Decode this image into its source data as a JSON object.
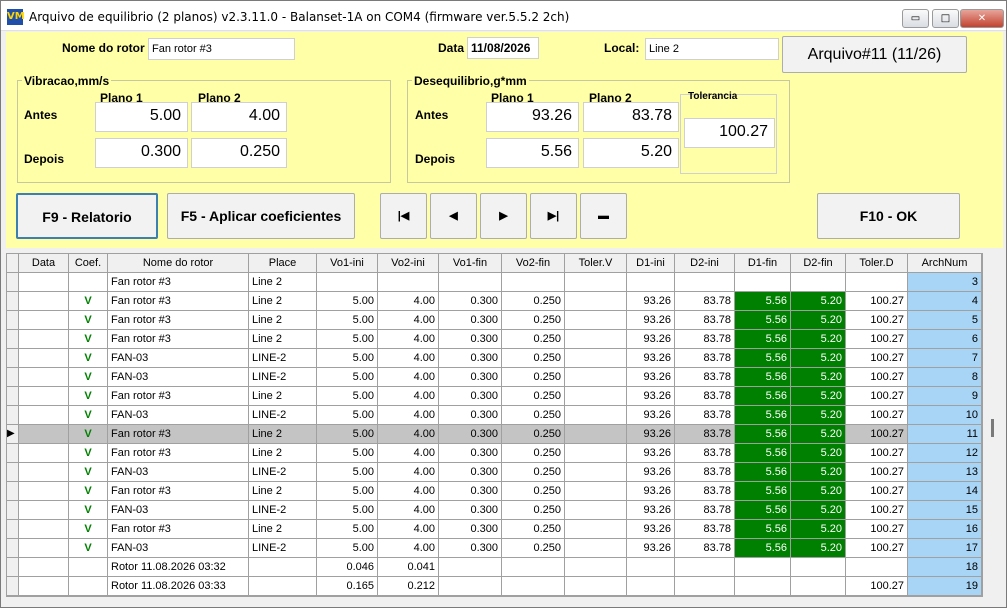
{
  "window": {
    "title": "Arquivo de equilibrio (2 planos) v2.3.11.0 - Balanset-1A on COM4 (firmware ver.5.5.2 2ch)",
    "icon_text": "VM",
    "btn_minimize": "▭",
    "btn_maximize": "□",
    "btn_close": "✕"
  },
  "header": {
    "rotor_label": "Nome do rotor",
    "rotor_value": "Fan rotor #3",
    "date_label": "Data",
    "date_value": "11/08/2026",
    "local_label": "Local:",
    "local_value": "Line 2",
    "archive_button": "Arquivo#11 (11/26)"
  },
  "vibration": {
    "title": "Vibracao,mm/s",
    "plano1_label": "Plano 1",
    "plano2_label": "Plano 2",
    "antes_label": "Antes",
    "depois_label": "Depois",
    "antes_p1": "5.00",
    "antes_p2": "4.00",
    "depois_p1": "0.300",
    "depois_p2": "0.250"
  },
  "imbalance": {
    "title": "Desequilibrio,g*mm",
    "plano1_label": "Plano 1",
    "plano2_label": "Plano 2",
    "tolerance_label": "Tolerancia",
    "antes_label": "Antes",
    "depois_label": "Depois",
    "antes_p1": "93.26",
    "antes_p2": "83.78",
    "depois_p1": "5.56",
    "depois_p2": "5.20",
    "tolerance_value": "100.27"
  },
  "buttons": {
    "report": "F9 - Relatorio",
    "apply": "F5 - Aplicar coeficientes",
    "ok": "F10 - OK",
    "nav_first": "|◀",
    "nav_prev": "◀",
    "nav_next": "▶",
    "nav_last": "▶|",
    "nav_delete": "▬"
  },
  "table": {
    "columns": [
      "Data",
      "Coef.",
      "Nome do rotor",
      "Place",
      "Vo1-ini",
      "Vo2-ini",
      "Vo1-fin",
      "Vo2-fin",
      "Toler.V",
      "D1-ini",
      "D2-ini",
      "D1-fin",
      "D2-fin",
      "Toler.D",
      "ArchNum"
    ],
    "selected_indicator": "▶",
    "rows": [
      [
        "",
        "",
        "Fan rotor #3",
        "Line 2",
        "",
        "",
        "",
        "",
        "",
        "",
        "",
        "",
        "",
        "",
        "3"
      ],
      [
        "",
        "V",
        "Fan rotor #3",
        "Line 2",
        "5.00",
        "4.00",
        "0.300",
        "0.250",
        "",
        "93.26",
        "83.78",
        "5.56",
        "5.20",
        "100.27",
        "4"
      ],
      [
        "",
        "V",
        "Fan rotor #3",
        "Line 2",
        "5.00",
        "4.00",
        "0.300",
        "0.250",
        "",
        "93.26",
        "83.78",
        "5.56",
        "5.20",
        "100.27",
        "5"
      ],
      [
        "",
        "V",
        "Fan rotor #3",
        "Line 2",
        "5.00",
        "4.00",
        "0.300",
        "0.250",
        "",
        "93.26",
        "83.78",
        "5.56",
        "5.20",
        "100.27",
        "6"
      ],
      [
        "",
        "V",
        "FAN-03",
        "LINE-2",
        "5.00",
        "4.00",
        "0.300",
        "0.250",
        "",
        "93.26",
        "83.78",
        "5.56",
        "5.20",
        "100.27",
        "7"
      ],
      [
        "",
        "V",
        "FAN-03",
        "LINE-2",
        "5.00",
        "4.00",
        "0.300",
        "0.250",
        "",
        "93.26",
        "83.78",
        "5.56",
        "5.20",
        "100.27",
        "8"
      ],
      [
        "",
        "V",
        "Fan rotor #3",
        "Line 2",
        "5.00",
        "4.00",
        "0.300",
        "0.250",
        "",
        "93.26",
        "83.78",
        "5.56",
        "5.20",
        "100.27",
        "9"
      ],
      [
        "",
        "V",
        "FAN-03",
        "LINE-2",
        "5.00",
        "4.00",
        "0.300",
        "0.250",
        "",
        "93.26",
        "83.78",
        "5.56",
        "5.20",
        "100.27",
        "10"
      ],
      [
        "",
        "V",
        "Fan rotor #3",
        "Line 2",
        "5.00",
        "4.00",
        "0.300",
        "0.250",
        "",
        "93.26",
        "83.78",
        "5.56",
        "5.20",
        "100.27",
        "11"
      ],
      [
        "",
        "V",
        "Fan rotor #3",
        "Line 2",
        "5.00",
        "4.00",
        "0.300",
        "0.250",
        "",
        "93.26",
        "83.78",
        "5.56",
        "5.20",
        "100.27",
        "12"
      ],
      [
        "",
        "V",
        "FAN-03",
        "LINE-2",
        "5.00",
        "4.00",
        "0.300",
        "0.250",
        "",
        "93.26",
        "83.78",
        "5.56",
        "5.20",
        "100.27",
        "13"
      ],
      [
        "",
        "V",
        "Fan rotor #3",
        "Line 2",
        "5.00",
        "4.00",
        "0.300",
        "0.250",
        "",
        "93.26",
        "83.78",
        "5.56",
        "5.20",
        "100.27",
        "14"
      ],
      [
        "",
        "V",
        "FAN-03",
        "LINE-2",
        "5.00",
        "4.00",
        "0.300",
        "0.250",
        "",
        "93.26",
        "83.78",
        "5.56",
        "5.20",
        "100.27",
        "15"
      ],
      [
        "",
        "V",
        "Fan rotor #3",
        "Line 2",
        "5.00",
        "4.00",
        "0.300",
        "0.250",
        "",
        "93.26",
        "83.78",
        "5.56",
        "5.20",
        "100.27",
        "16"
      ],
      [
        "",
        "V",
        "FAN-03",
        "LINE-2",
        "5.00",
        "4.00",
        "0.300",
        "0.250",
        "",
        "93.26",
        "83.78",
        "5.56",
        "5.20",
        "100.27",
        "17"
      ],
      [
        "",
        "",
        "Rotor 11.08.2026 03:32",
        "",
        "0.046",
        "0.041",
        "",
        "",
        "",
        "",
        "",
        "",
        "",
        "",
        "18"
      ],
      [
        "",
        "",
        "Rotor 11.08.2026 03:33",
        "",
        "0.165",
        "0.212",
        "",
        "",
        "",
        "",
        "",
        "",
        "",
        "100.27",
        "19"
      ]
    ],
    "selected_row": 8,
    "colors": {
      "d_fin_bg": "#008000",
      "archnum_bg": "#a8d4f5",
      "selected_bg": "#c4c4c4"
    }
  }
}
